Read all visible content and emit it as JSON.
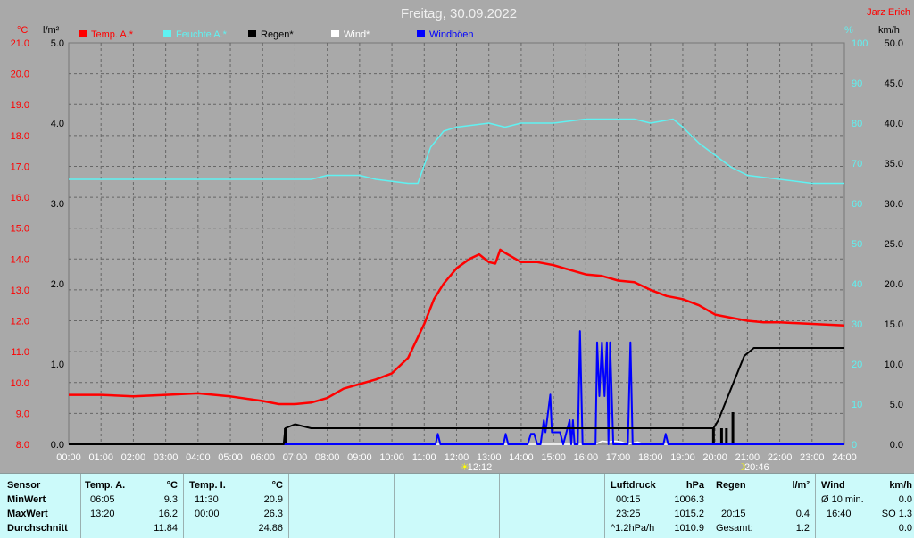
{
  "title": "Freitag, 30.09.2022",
  "author": "Jarz Erich",
  "units": {
    "left_temp": "°C",
    "left_rain": "l/m²",
    "right_hum": "%",
    "right_wind": "km/h"
  },
  "legend": [
    {
      "label": "Temp. A.*",
      "color": "#ff0000"
    },
    {
      "label": "Feuchte A.*",
      "color": "#5ff2f2"
    },
    {
      "label": "Regen*",
      "color": "#000000"
    },
    {
      "label": "Wind*",
      "color": "#ffffff"
    },
    {
      "label": "Windböen",
      "color": "#0000ff"
    }
  ],
  "sun_markers": [
    {
      "label": "12:12",
      "hour": 12.2
    },
    {
      "label": "20:46",
      "hour": 20.77
    }
  ],
  "chart_data": {
    "type": "line",
    "x_unit": "hour",
    "x_ticks": [
      "00:00",
      "01:00",
      "02:00",
      "03:00",
      "04:00",
      "05:00",
      "06:00",
      "07:00",
      "08:00",
      "09:00",
      "10:00",
      "11:00",
      "12:00",
      "13:00",
      "14:00",
      "15:00",
      "16:00",
      "17:00",
      "18:00",
      "19:00",
      "20:00",
      "21:00",
      "22:00",
      "23:00",
      "24:00"
    ],
    "xlim": [
      0,
      24
    ],
    "axes": {
      "temp": {
        "ylim": [
          8,
          21
        ],
        "ticks": [
          "8.0",
          "9.0",
          "10.0",
          "11.0",
          "12.0",
          "13.0",
          "14.0",
          "15.0",
          "16.0",
          "17.0",
          "18.0",
          "19.0",
          "20.0",
          "21.0"
        ],
        "color": "#ff0000"
      },
      "rain": {
        "ylim": [
          0,
          5
        ],
        "ticks": [
          "0.0",
          "1.0",
          "2.0",
          "3.0",
          "4.0",
          "5.0"
        ],
        "color": "#000000"
      },
      "humidity": {
        "ylim": [
          0,
          100
        ],
        "ticks": [
          "0",
          "10",
          "20",
          "30",
          "40",
          "50",
          "60",
          "70",
          "80",
          "90",
          "100"
        ],
        "color": "#5ff2f2"
      },
      "wind": {
        "ylim": [
          0,
          50
        ],
        "ticks": [
          "0.0",
          "5.0",
          "10.0",
          "15.0",
          "20.0",
          "25.0",
          "30.0",
          "35.0",
          "40.0",
          "45.0",
          "50.0"
        ],
        "color": "#000000"
      }
    },
    "grid": true,
    "series": [
      {
        "name": "Temp. A.*",
        "axis": "temp",
        "color": "#ff0000",
        "width": 2.5,
        "points": [
          [
            0,
            9.6
          ],
          [
            1,
            9.6
          ],
          [
            2,
            9.55
          ],
          [
            3,
            9.6
          ],
          [
            4,
            9.65
          ],
          [
            5,
            9.55
          ],
          [
            6,
            9.4
          ],
          [
            6.5,
            9.3
          ],
          [
            7,
            9.3
          ],
          [
            7.5,
            9.35
          ],
          [
            8,
            9.5
          ],
          [
            8.5,
            9.8
          ],
          [
            9,
            9.95
          ],
          [
            9.5,
            10.1
          ],
          [
            10,
            10.3
          ],
          [
            10.5,
            10.8
          ],
          [
            11,
            11.9
          ],
          [
            11.3,
            12.7
          ],
          [
            11.6,
            13.2
          ],
          [
            12,
            13.7
          ],
          [
            12.4,
            14.0
          ],
          [
            12.7,
            14.15
          ],
          [
            13,
            13.9
          ],
          [
            13.2,
            13.85
          ],
          [
            13.35,
            14.3
          ],
          [
            13.5,
            14.2
          ],
          [
            14,
            13.9
          ],
          [
            14.5,
            13.9
          ],
          [
            15,
            13.8
          ],
          [
            15.5,
            13.65
          ],
          [
            16,
            13.5
          ],
          [
            16.5,
            13.45
          ],
          [
            17,
            13.3
          ],
          [
            17.5,
            13.25
          ],
          [
            18,
            13.0
          ],
          [
            18.5,
            12.8
          ],
          [
            19,
            12.7
          ],
          [
            19.5,
            12.5
          ],
          [
            20,
            12.2
          ],
          [
            20.5,
            12.1
          ],
          [
            21,
            12.0
          ],
          [
            21.5,
            11.95
          ],
          [
            22,
            11.95
          ],
          [
            23,
            11.9
          ],
          [
            24,
            11.85
          ]
        ]
      },
      {
        "name": "Feuchte A.*",
        "axis": "humidity",
        "color": "#5ff2f2",
        "width": 1.5,
        "points": [
          [
            0,
            66
          ],
          [
            2,
            66
          ],
          [
            4,
            66
          ],
          [
            6,
            66
          ],
          [
            7.5,
            66
          ],
          [
            8,
            67
          ],
          [
            9,
            67
          ],
          [
            9.5,
            66
          ],
          [
            10.5,
            65
          ],
          [
            10.8,
            65
          ],
          [
            11.2,
            74
          ],
          [
            11.6,
            78
          ],
          [
            12,
            79
          ],
          [
            13,
            80
          ],
          [
            13.5,
            79
          ],
          [
            14,
            80
          ],
          [
            15,
            80
          ],
          [
            16,
            81
          ],
          [
            17,
            81
          ],
          [
            17.5,
            81
          ],
          [
            18,
            80
          ],
          [
            18.7,
            81
          ],
          [
            19,
            79
          ],
          [
            19.5,
            75
          ],
          [
            20,
            72
          ],
          [
            20.5,
            69
          ],
          [
            21,
            67
          ],
          [
            22,
            66
          ],
          [
            23,
            65
          ],
          [
            24,
            65
          ]
        ]
      },
      {
        "name": "Regen*",
        "axis": "rain",
        "color": "#000000",
        "width": 2,
        "points": [
          [
            0,
            0
          ],
          [
            6.65,
            0
          ],
          [
            6.7,
            0.2
          ],
          [
            7,
            0.25
          ],
          [
            7.5,
            0.2
          ],
          [
            8,
            0.2
          ],
          [
            10,
            0.2
          ],
          [
            15,
            0.2
          ],
          [
            19,
            0.2
          ],
          [
            19.95,
            0.2
          ],
          [
            20.1,
            0.3
          ],
          [
            20.3,
            0.5
          ],
          [
            20.6,
            0.8
          ],
          [
            20.9,
            1.1
          ],
          [
            21.2,
            1.2
          ],
          [
            21.5,
            1.2
          ],
          [
            22,
            1.2
          ],
          [
            24,
            1.2
          ]
        ]
      },
      {
        "name": "Wind*",
        "axis": "wind",
        "color": "#ffffff",
        "width": 1.5,
        "points": [
          [
            0,
            0
          ],
          [
            16.3,
            0
          ],
          [
            16.5,
            0.4
          ],
          [
            16.7,
            0.3
          ],
          [
            16.9,
            0.4
          ],
          [
            17.1,
            0.3
          ],
          [
            17.3,
            0
          ],
          [
            17.6,
            0.3
          ],
          [
            17.8,
            0
          ],
          [
            24,
            0
          ]
        ]
      },
      {
        "name": "Windböen",
        "axis": "wind",
        "color": "#0000ff",
        "width": 2,
        "points": [
          [
            0,
            0
          ],
          [
            11.35,
            0
          ],
          [
            11.42,
            1.3
          ],
          [
            11.5,
            0
          ],
          [
            13.45,
            0
          ],
          [
            13.52,
            1.3
          ],
          [
            13.6,
            0
          ],
          [
            14.2,
            0
          ],
          [
            14.3,
            1.3
          ],
          [
            14.4,
            1.3
          ],
          [
            14.5,
            0
          ],
          [
            14.6,
            0
          ],
          [
            14.7,
            3.0
          ],
          [
            14.75,
            1.5
          ],
          [
            14.8,
            3.0
          ],
          [
            14.9,
            6.2
          ],
          [
            14.95,
            1.5
          ],
          [
            15.2,
            1.5
          ],
          [
            15.3,
            0
          ],
          [
            15.4,
            1.5
          ],
          [
            15.5,
            3.0
          ],
          [
            15.55,
            0
          ],
          [
            15.6,
            3.0
          ],
          [
            15.65,
            0
          ],
          [
            15.75,
            0
          ],
          [
            15.82,
            14.1
          ],
          [
            15.9,
            0
          ],
          [
            16.3,
            0
          ],
          [
            16.35,
            12.7
          ],
          [
            16.42,
            6.0
          ],
          [
            16.5,
            12.7
          ],
          [
            16.58,
            6.0
          ],
          [
            16.65,
            12.7
          ],
          [
            16.7,
            0
          ],
          [
            16.75,
            12.7
          ],
          [
            16.85,
            0
          ],
          [
            17.3,
            0
          ],
          [
            17.38,
            12.7
          ],
          [
            17.45,
            0
          ],
          [
            18.4,
            0
          ],
          [
            18.47,
            1.3
          ],
          [
            18.55,
            0
          ],
          [
            24,
            0
          ]
        ]
      }
    ],
    "rain_bars": [
      {
        "hour": 6.7,
        "value": 0.2
      },
      {
        "hour": 19.95,
        "value": 0.2
      },
      {
        "hour": 20.2,
        "value": 0.2
      },
      {
        "hour": 20.35,
        "value": 0.2
      },
      {
        "hour": 20.55,
        "value": 0.4
      }
    ]
  },
  "stats": {
    "sensor": {
      "header": "Sensor",
      "rows": [
        "MinWert",
        "MaxWert",
        "Durchschnitt"
      ]
    },
    "temp_a": {
      "header": "Temp. A.",
      "unit": "°C",
      "rows": [
        {
          "time": "06:05",
          "value": "9.3"
        },
        {
          "time": "13:20",
          "value": "16.2"
        },
        {
          "time": "",
          "value": "11.84"
        }
      ]
    },
    "temp_i": {
      "header": "Temp. I.",
      "unit": "°C",
      "rows": [
        {
          "time": "11:30",
          "value": "20.9"
        },
        {
          "time": "00:00",
          "value": "26.3"
        },
        {
          "time": "",
          "value": "24.86"
        }
      ]
    },
    "luftdruck": {
      "header": "Luftdruck",
      "unit": "hPa",
      "rows": [
        {
          "time": "00:15",
          "value": "1006.3"
        },
        {
          "time": "23:25",
          "value": "1015.2"
        },
        {
          "time": "^1.2hPa/h",
          "value": "1010.9"
        }
      ]
    },
    "regen": {
      "header": "Regen",
      "unit": "l/m²",
      "rows": [
        {
          "time": "",
          "value": ""
        },
        {
          "time": "20:15",
          "value": "0.4"
        },
        {
          "time": "Gesamt:",
          "value": "1.2"
        }
      ]
    },
    "wind": {
      "header": "Wind",
      "unit": "km/h",
      "rows": [
        {
          "time": "Ø 10 min.",
          "value": "0.0"
        },
        {
          "time": "16:40",
          "value": "SO 1.3"
        },
        {
          "time": "",
          "value": "0.0"
        }
      ]
    }
  }
}
